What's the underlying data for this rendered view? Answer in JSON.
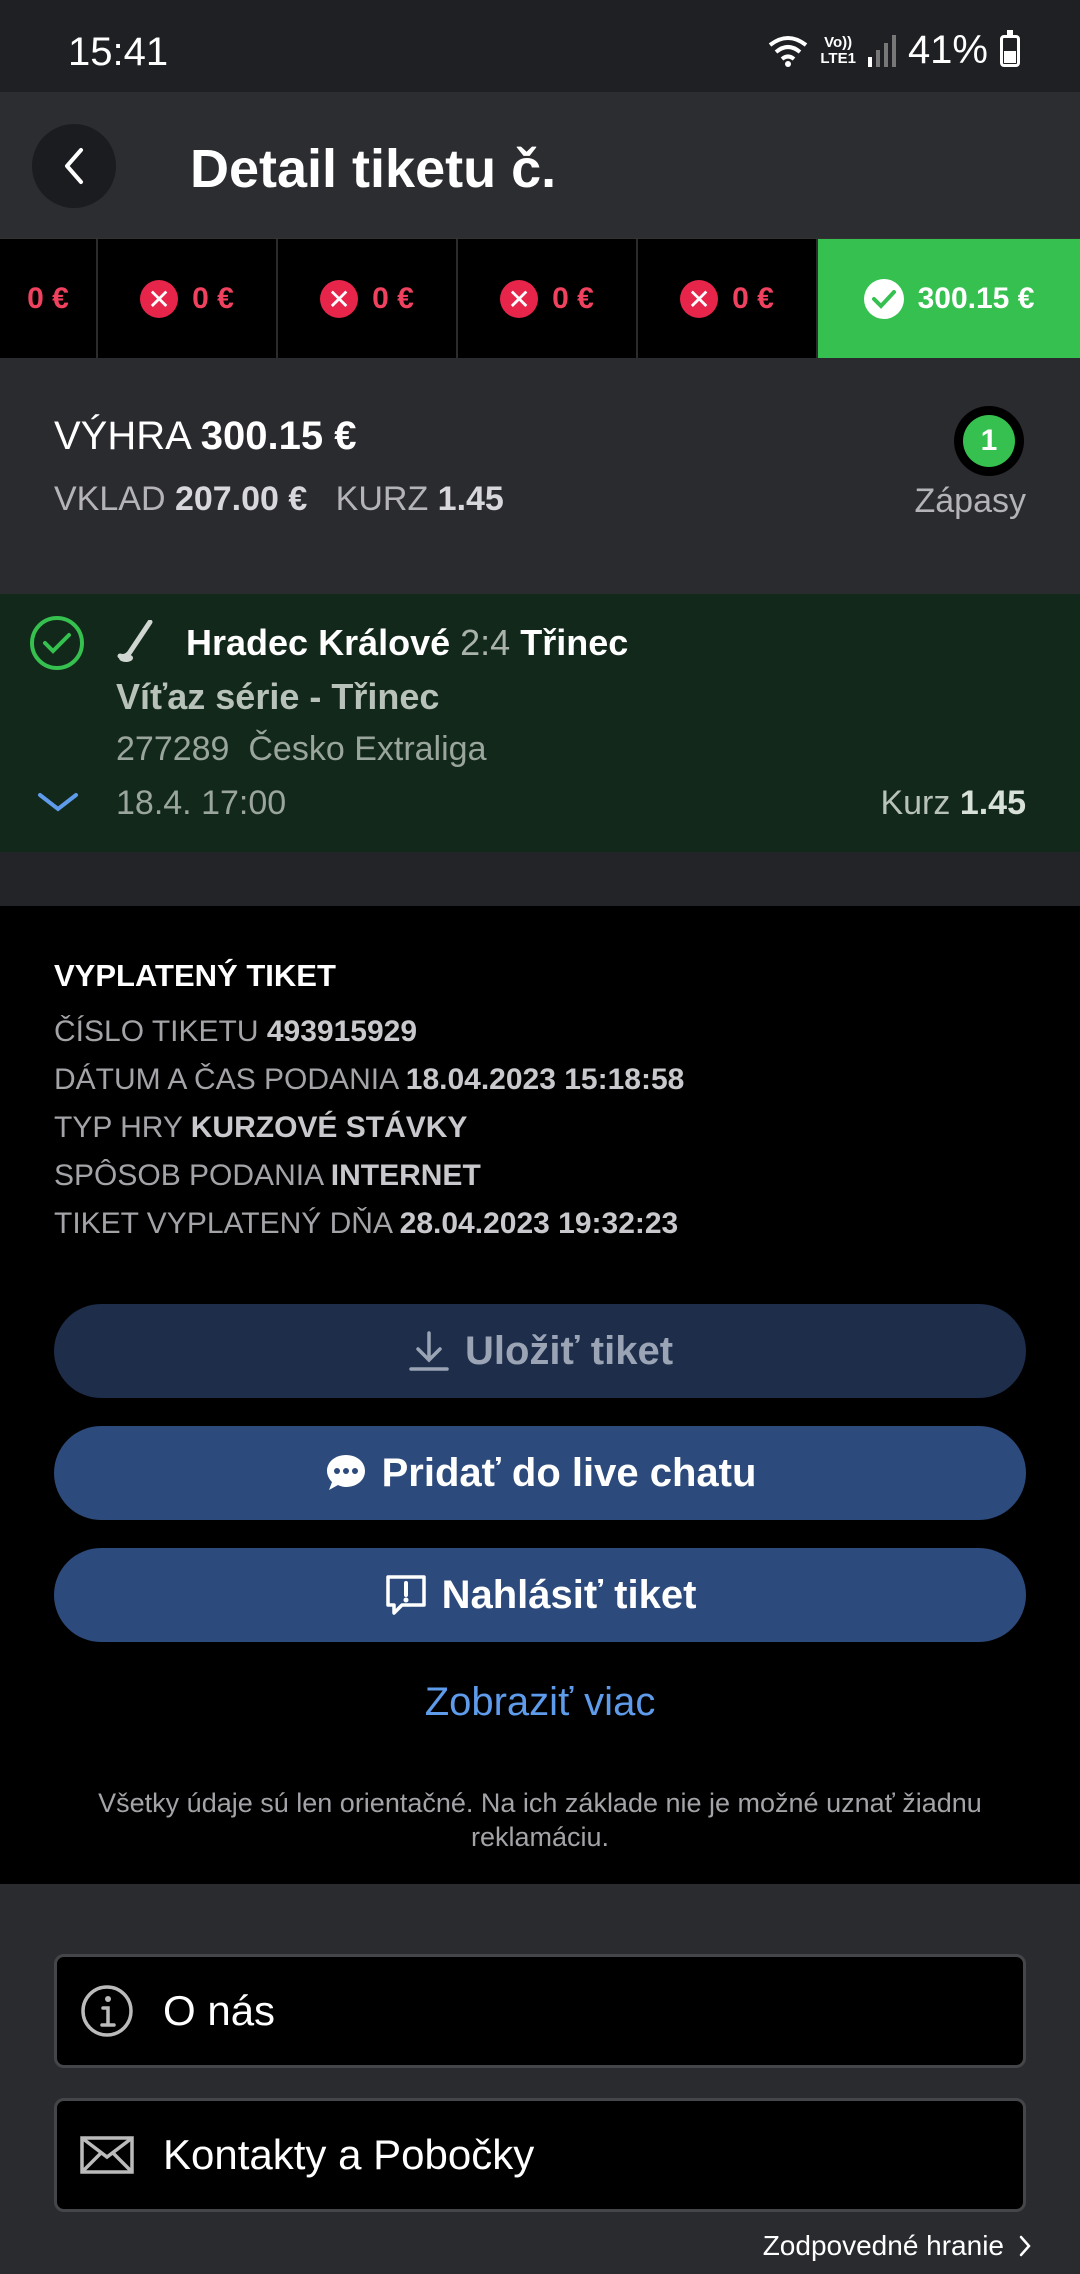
{
  "status_bar": {
    "time": "15:41",
    "volte_top": "Vo))",
    "volte_bottom": "LTE1",
    "battery": "41%"
  },
  "header": {
    "title": "Detail tiketu č."
  },
  "ticket_tabs": [
    {
      "amount": "0 €",
      "status": "lost"
    },
    {
      "amount": "0 €",
      "status": "lost"
    },
    {
      "amount": "0 €",
      "status": "lost"
    },
    {
      "amount": "0 €",
      "status": "lost"
    },
    {
      "amount": "0 €",
      "status": "lost"
    },
    {
      "amount": "300.15 €",
      "status": "won"
    }
  ],
  "summary": {
    "win_label": "VÝHRA",
    "win_value": "300.15 €",
    "stake_label": "VKLAD",
    "stake_value": "207.00 €",
    "odds_label": "KURZ",
    "odds_value": "1.45",
    "matches_count": "1",
    "matches_label": "Zápasy"
  },
  "event": {
    "home": "Hradec Králové",
    "score": "2:4",
    "away": "Třinec",
    "bet": "Víťaz série - Třinec",
    "event_id": "277289",
    "league": "Česko Extraliga",
    "datetime": "18.4. 17:00",
    "odds_label": "Kurz",
    "odds_value": "1.45"
  },
  "info": {
    "heading": "VYPLATENÝ TIKET",
    "rows": [
      {
        "label": "ČÍSLO TIKETU",
        "value": "493915929"
      },
      {
        "label": "DÁTUM A ČAS PODANIA",
        "value": "18.04.2023 15:18:58"
      },
      {
        "label": "TYP HRY",
        "value": "KURZOVÉ STÁVKY"
      },
      {
        "label": "SPÔSOB PODANIA",
        "value": "INTERNET"
      },
      {
        "label": "TIKET VYPLATENÝ DŇA",
        "value": "28.04.2023 19:32:23"
      }
    ]
  },
  "actions": {
    "save": "Uložiť tiket",
    "live_chat": "Pridať do live chatu",
    "report": "Nahlásiť tiket",
    "show_more": "Zobraziť viac"
  },
  "disclaimer": "Všetky údaje sú len orientačné. Na ich základe nie je možné uznať žiadnu reklamáciu.",
  "footer": {
    "about": "O nás",
    "contacts": "Kontakty a Pobočky",
    "responsible": "Zodpovedné hranie"
  },
  "colors": {
    "win_green": "#35c04f",
    "loss_red": "#e7244a",
    "button_blue": "#2d4a7c",
    "link_blue": "#5e9bea"
  }
}
